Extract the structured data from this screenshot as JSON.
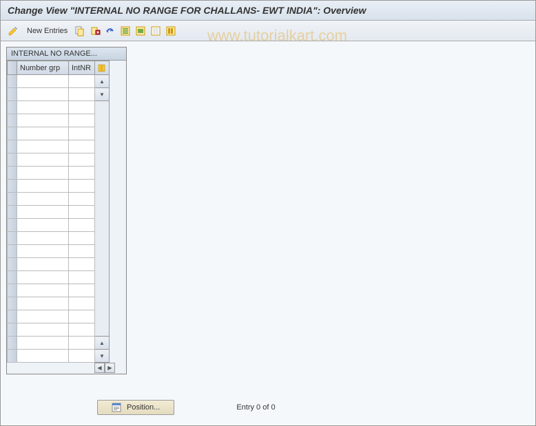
{
  "title": "Change View \"INTERNAL NO RANGE FOR CHALLANS- EWT INDIA\": Overview",
  "toolbar": {
    "new_entries": "New Entries"
  },
  "table": {
    "title": "INTERNAL NO RANGE...",
    "columns": {
      "number_grp": "Number grp",
      "intnr": "IntNR"
    },
    "row_count": 22
  },
  "bottom": {
    "position": "Position...",
    "entry_status": "Entry 0 of 0"
  },
  "watermark": "www.tutorialkart.com"
}
